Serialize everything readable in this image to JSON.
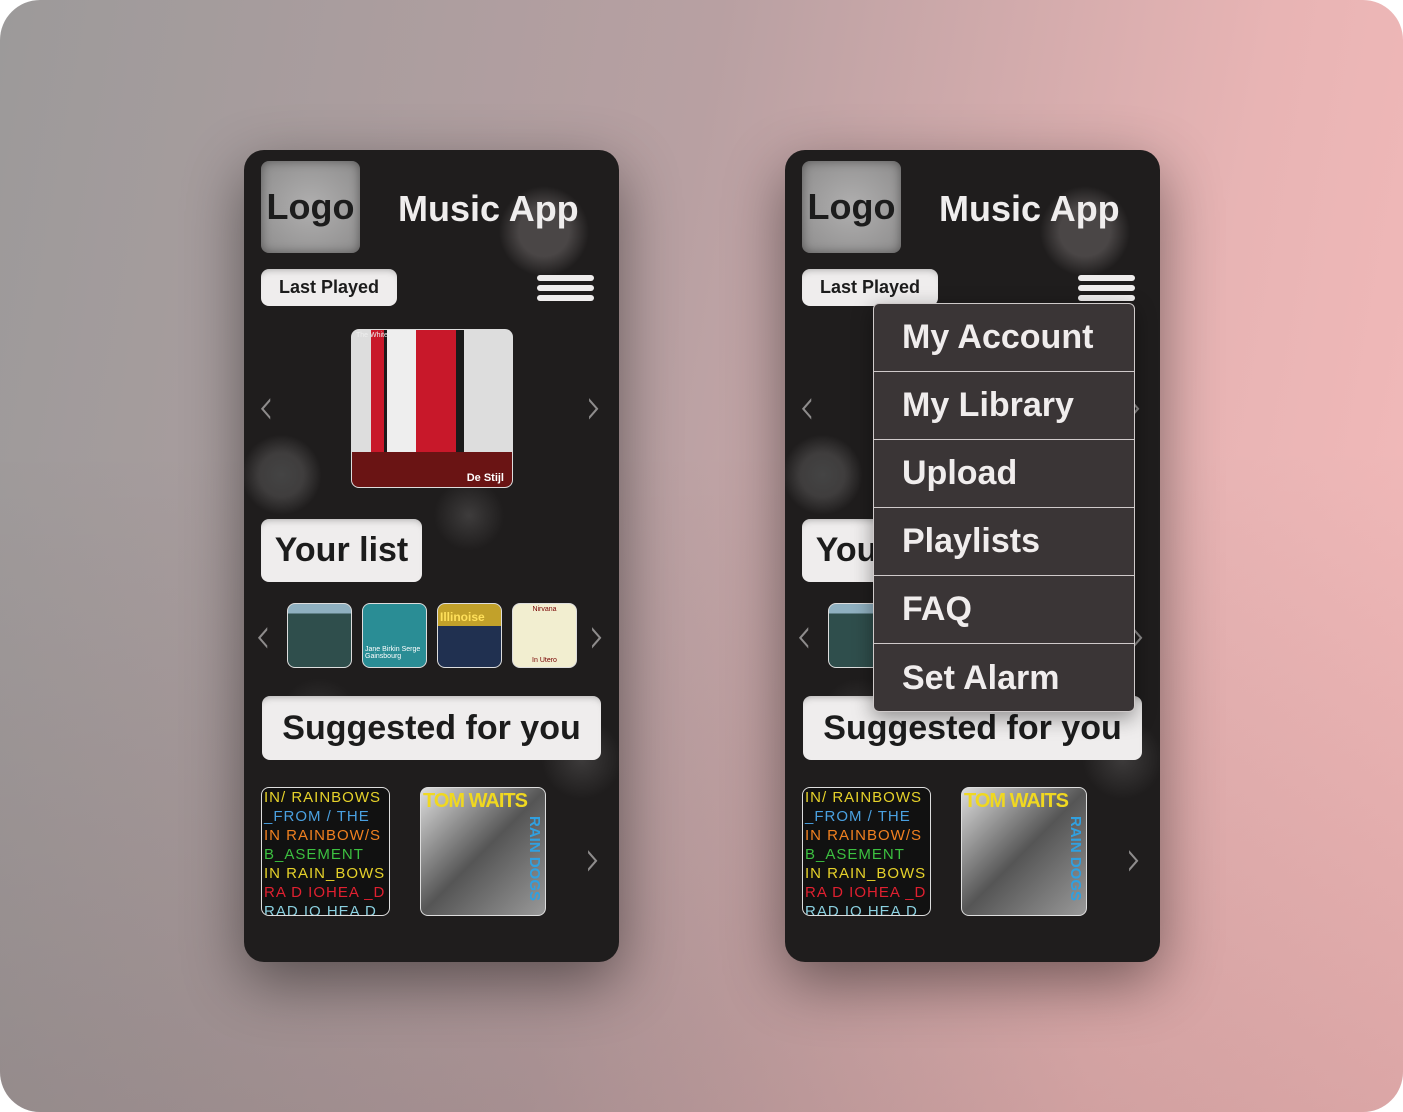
{
  "app": {
    "logo": "Logo",
    "title": "Music App",
    "last_played": "Last Played",
    "your_list": "Your list",
    "suggested": "Suggested for you"
  },
  "now_playing": {
    "band": "The White Stripes",
    "album": "De Stijl"
  },
  "your_list": [
    {
      "artist": "",
      "album": ""
    },
    {
      "artist": "Jane Birkin Serge Gainsbourg",
      "album": ""
    },
    {
      "artist": "",
      "album": "Illinoise"
    },
    {
      "artist": "Nirvana",
      "album": "In Utero"
    }
  ],
  "suggested": {
    "radiohead_lines": [
      "IN/ RAINBOWS",
      "_FROM / THE",
      "IN RAINBOW/S",
      "B_ASEMENT",
      "IN RAIN_BOWS",
      "RA D IOHEA _D",
      "RAD IO HEA D"
    ],
    "tom_waits": {
      "artist": "TOM WAITS",
      "album": "RAIN DOGS"
    }
  },
  "menu": {
    "items": [
      "My Account",
      "My Library",
      "Upload",
      "Playlists",
      "FAQ",
      "Set Alarm"
    ]
  },
  "icons": {
    "prev": "chevron-left-icon",
    "next": "chevron-right-icon",
    "menu": "hamburger-menu-icon"
  }
}
